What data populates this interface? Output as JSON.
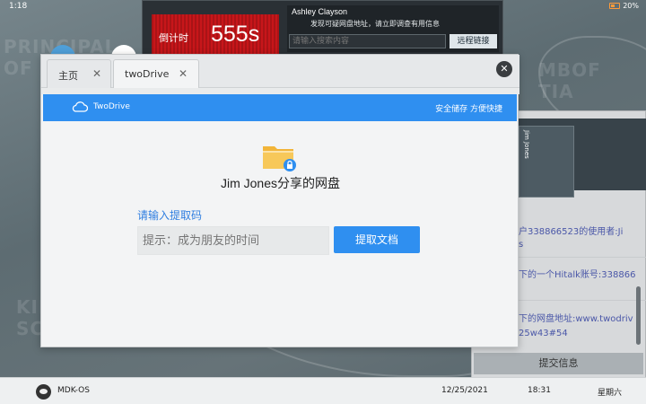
{
  "status_bar": {
    "time": "1:18",
    "battery": "20%"
  },
  "countdown": {
    "label": "倒计时",
    "value": "555s"
  },
  "message": {
    "sender": "Ashley Clayson",
    "text": "发现可疑网盘地址，请立即调查有用信息",
    "search_placeholder": "请输入搜索内容",
    "remote_link_label": "远程链接"
  },
  "background_text": {
    "left_top": "PRINCIPAL\nOF A",
    "right_top": "MBOF\nTIA",
    "left_bottom": "KIN\nSC"
  },
  "browser": {
    "tabs": [
      {
        "label": "主页",
        "close": "✕"
      },
      {
        "label": "twoDrive",
        "close": "✕"
      }
    ],
    "close_icon": "✕",
    "site_name": "TwoDrive",
    "site_tagline": "安全储存 方便快捷",
    "owner_title": "Jim Jones分享的网盘",
    "code_label": "请输入提取码",
    "code_placeholder": "提示：成为朋友的时间",
    "extract_button": "提取文档"
  },
  "right_panel": {
    "phone_label": "Jim Jones",
    "chat_lines": [
      "户338866523的使用者:Ji",
      "s",
      "下的一个Hitalk账号:338866",
      "下的网盘地址:www.twodriv",
      "25w43#54"
    ],
    "submit_label": "提交信息"
  },
  "taskbar": {
    "os_name": "MDK-OS",
    "date": "12/25/2021",
    "time": "18:31",
    "weekday": "星期六"
  },
  "colors": {
    "accent": "#2f8ff0",
    "countdown_red": "#c7161a",
    "link_blue": "#2f7ee0"
  },
  "icons": [
    "battery-icon",
    "cloud-icon",
    "folder-lock-icon",
    "close-icon",
    "os-logo-icon"
  ]
}
